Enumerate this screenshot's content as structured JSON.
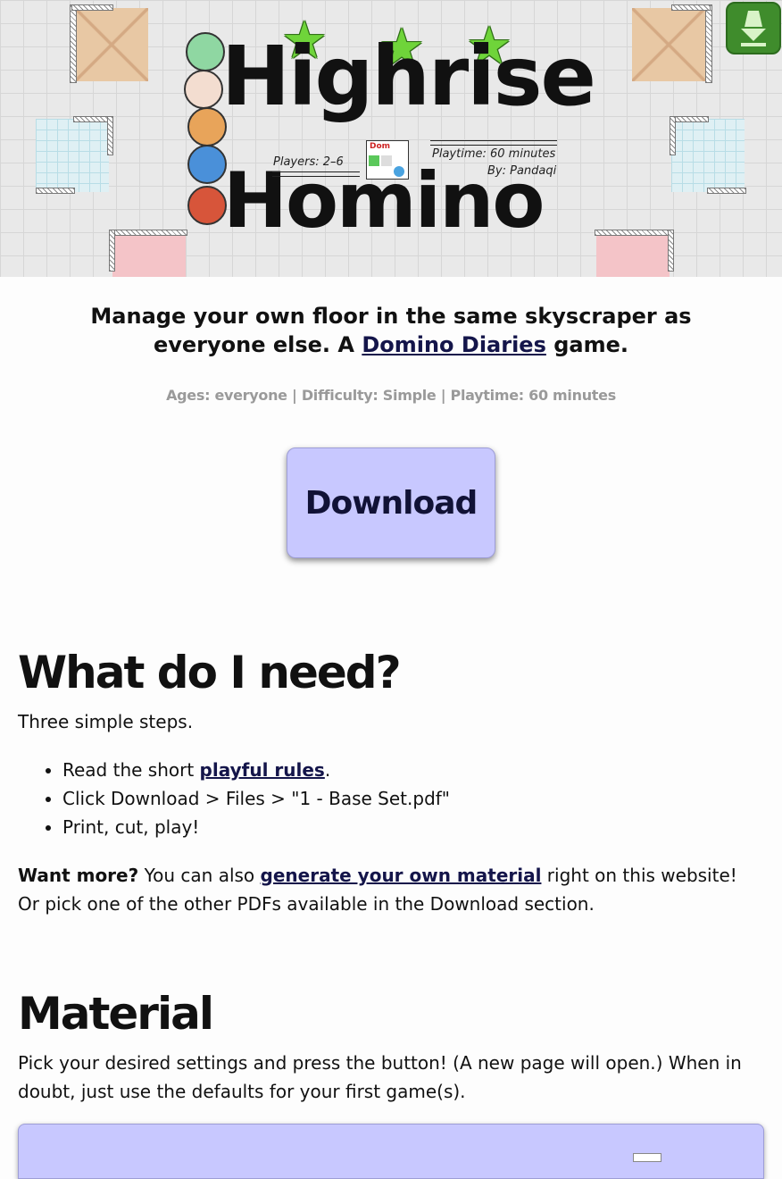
{
  "banner": {
    "logo_line1": "Highrise",
    "logo_line2": "Homino",
    "players": "Players: 2–6",
    "playtime": "Playtime: 60 minutes",
    "author": "By: Pandaqi",
    "domino_label": "Dom"
  },
  "corner_button": {
    "icon": "download-arrow-icon",
    "color": "#3f8c2c"
  },
  "tagline": {
    "before": "Manage your own floor in the same skyscraper as everyone else. A ",
    "link": "Domino Diaries",
    "after": " game."
  },
  "meta": "Ages: everyone | Difficulty: Simple | Playtime: 60 minutes",
  "download_button": "Download",
  "need": {
    "heading": "What do I need?",
    "intro": "Three simple steps.",
    "step1_before": "Read the short ",
    "step1_link": "playful rules",
    "step1_after": ".",
    "step2": "Click Download > Files > \"1 - Base Set.pdf\"",
    "step3": "Print, cut, play!",
    "more_bold": "Want more?",
    "more_before": " You can also ",
    "more_link": "generate your own material",
    "more_after": " right on this website! Or pick one of the other PDFs available in the Download section."
  },
  "material": {
    "heading": "Material",
    "text": "Pick your desired settings and press the button! (A new page will open.) When in doubt, just use the defaults for your first game(s)."
  },
  "colors": {
    "accent": "#c8c8ff",
    "link": "#14154a",
    "meta": "#9a9a9a"
  }
}
